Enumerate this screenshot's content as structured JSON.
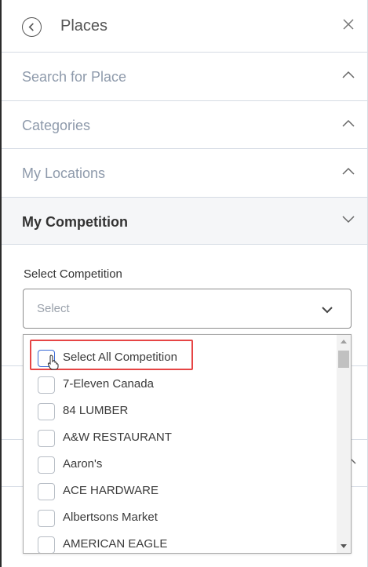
{
  "header": {
    "title": "Places",
    "back_icon": "back-arrow-circle-icon",
    "close_icon": "close-icon"
  },
  "sections": [
    {
      "label": "Search for Place",
      "state": "collapsed",
      "chevron": "chevron-up-icon"
    },
    {
      "label": "Categories",
      "state": "collapsed",
      "chevron": "chevron-up-icon"
    },
    {
      "label": "My Locations",
      "state": "collapsed",
      "chevron": "chevron-up-icon"
    },
    {
      "label": "My Competition",
      "state": "expanded",
      "chevron": "chevron-down-icon"
    }
  ],
  "competition": {
    "field_label": "Select Competition",
    "select_placeholder": "Select",
    "options": [
      {
        "label": "Select All Competition",
        "checked": false
      },
      {
        "label": "7-Eleven Canada",
        "checked": false
      },
      {
        "label": "84 LUMBER",
        "checked": false
      },
      {
        "label": "A&W RESTAURANT",
        "checked": false
      },
      {
        "label": "Aaron's",
        "checked": false
      },
      {
        "label": "ACE HARDWARE",
        "checked": false
      },
      {
        "label": "Albertsons Market",
        "checked": false
      },
      {
        "label": "AMERICAN EAGLE",
        "checked": false
      }
    ]
  },
  "colors": {
    "accent_border": "#3b6bd6",
    "highlight": "#e64545",
    "muted_text": "#8e9aab"
  }
}
